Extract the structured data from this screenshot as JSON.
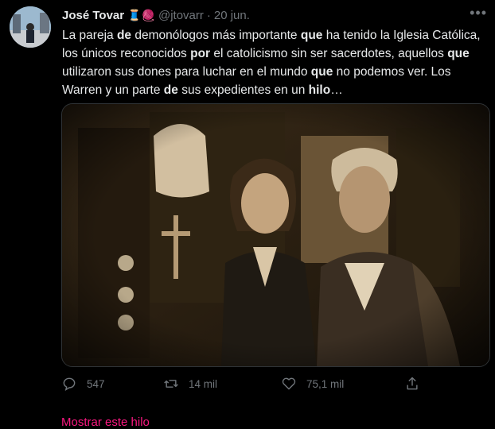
{
  "tweet": {
    "author_name": "José Tovar",
    "author_emojis": "🧵🧶",
    "handle": "@jtovarr",
    "separator": "·",
    "date": "20 jun.",
    "more_label": "•••",
    "text_parts": [
      {
        "t": "La pareja ",
        "b": false
      },
      {
        "t": "de",
        "b": true
      },
      {
        "t": " demonólogos más importante ",
        "b": false
      },
      {
        "t": "que",
        "b": true
      },
      {
        "t": " ha tenido la Iglesia Católica, los únicos reconocidos ",
        "b": false
      },
      {
        "t": "por",
        "b": true
      },
      {
        "t": " el catolicismo sin ser sacerdotes, aquellos ",
        "b": false
      },
      {
        "t": "que",
        "b": true
      },
      {
        "t": " utilizaron sus dones para luchar en el mundo ",
        "b": false
      },
      {
        "t": "que",
        "b": true
      },
      {
        "t": " no podemos ver. Los Warren y un parte ",
        "b": false
      },
      {
        "t": "de",
        "b": true
      },
      {
        "t": " sus expedientes en un ",
        "b": false
      },
      {
        "t": "hilo",
        "b": true
      },
      {
        "t": "…",
        "b": false
      }
    ],
    "image_icon": "photo-of-couple",
    "actions": {
      "reply_count": "547",
      "retweet_count": "14 mil",
      "like_count": "75,1 mil",
      "share_icon": "share-icon"
    },
    "show_thread_label": "Mostrar este hilo"
  },
  "colors": {
    "background": "#000000",
    "text": "#e7e9ea",
    "secondary": "#71767b",
    "accent": "#f91880"
  }
}
